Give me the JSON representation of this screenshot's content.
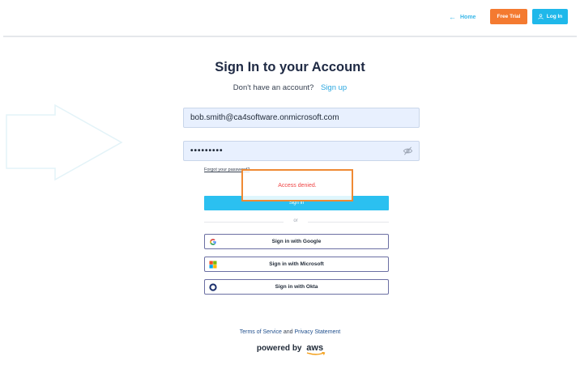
{
  "header": {
    "home_label": "Home",
    "free_trial_label": "Free Trial",
    "login_label": "Log In"
  },
  "form": {
    "title": "Sign In to your Account",
    "no_account_text": "Don't have an account?",
    "signup_label": "Sign up",
    "email_value": "bob.smith@ca4software.onmicrosoft.com",
    "password_value": "•••••••••",
    "forgot_label": "Forgot your password?",
    "error_message": "Access denied.",
    "signin_label": "Sign in",
    "or_label": "or",
    "google_label": "Sign in with Google",
    "microsoft_label": "Sign in with Microsoft",
    "okta_label": "Sign in with Okta"
  },
  "footer": {
    "terms_label": "Terms of Service",
    "and_text": "and",
    "privacy_label": "Privacy Statement",
    "powered_text": "powered by",
    "aws_text": "aws"
  },
  "colors": {
    "accent_blue": "#1fb8ea",
    "trial_orange": "#f47a30",
    "error_red": "#ef4444",
    "highlight_orange": "#ef8a34"
  }
}
